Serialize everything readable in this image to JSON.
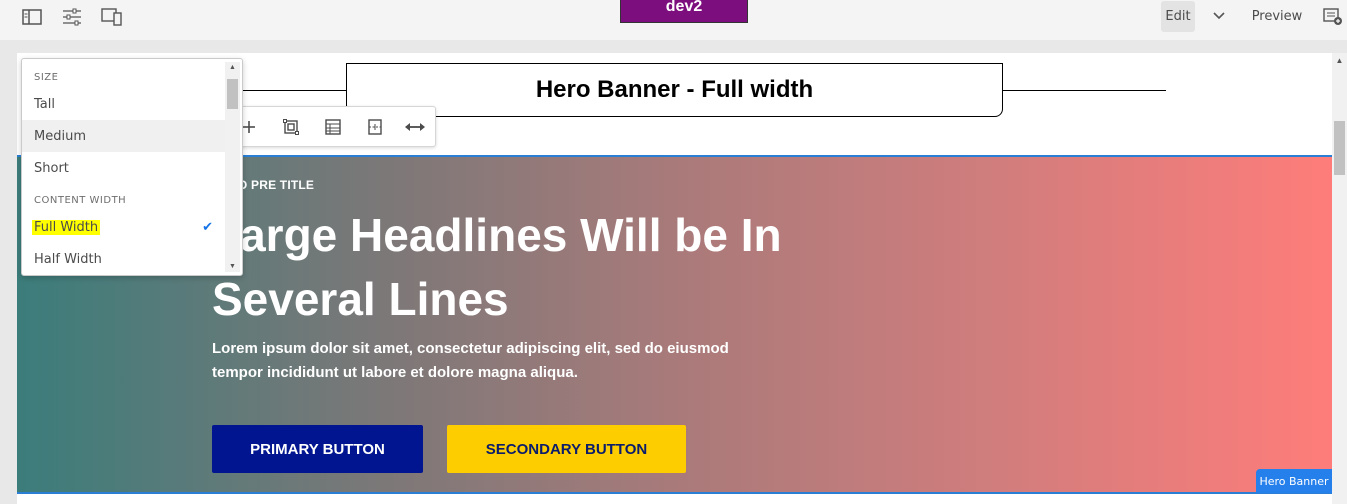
{
  "topbar": {
    "env_label": "dev2",
    "edit_label": "Edit",
    "preview_label": "Preview",
    "icons": [
      "side-panel-icon",
      "page-properties-icon",
      "emulator-icon",
      "chevron-down-icon",
      "annotations-icon"
    ]
  },
  "title_component": {
    "text": "Hero Banner - Full width"
  },
  "hero": {
    "pre_title": "HERO PRE TITLE",
    "headline": "Large Headlines Will be In Several Lines",
    "body": "Lorem ipsum dolor sit amet, consectetur adipiscing elit, sed do eiusmod tempor incididunt ut labore et dolore magna aliqua.",
    "primary_button": "PRIMARY BUTTON",
    "secondary_button": "SECONDARY BUTTON",
    "component_badge": "Hero Banner"
  },
  "style_menu": {
    "size_heading": "SIZE",
    "size_options": [
      "Tall",
      "Medium",
      "Short"
    ],
    "content_width_heading": "CONTENT WIDTH",
    "width_options": [
      "Full Width",
      "Half Width"
    ],
    "selected_width": "Full Width"
  },
  "colors": {
    "env_badge": "#7d0e7d",
    "primary_button": "#00158f",
    "secondary_button": "#fdcd00",
    "selection_check": "#1473e6",
    "highlight": "#ffff00",
    "hero_gradient_start": "#3b7d7b",
    "hero_gradient_end": "#fe7d7a"
  }
}
